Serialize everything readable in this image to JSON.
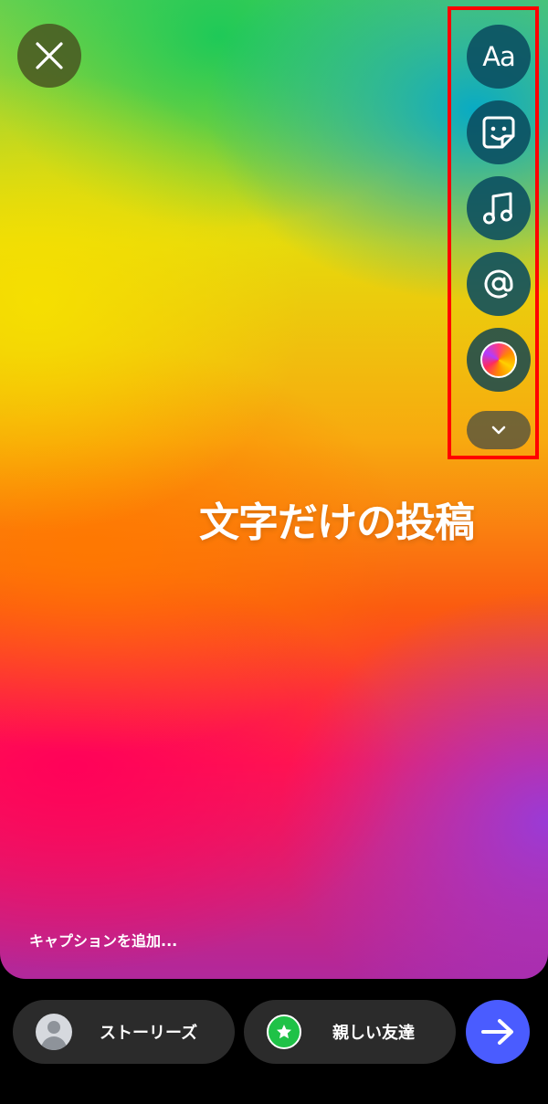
{
  "canvas": {
    "text": "文字だけの投稿",
    "caption_placeholder": "キャプションを追加..."
  },
  "toolbar": {
    "close_icon": "close-icon",
    "text_tool_label": "Aa",
    "tools": [
      "text-icon",
      "sticker-icon",
      "music-icon",
      "mention-icon",
      "color-gradient-icon",
      "chevron-down-icon"
    ]
  },
  "share": {
    "stories_label": "ストーリーズ",
    "close_friends_label": "親しい友達",
    "send_icon": "arrow-right-icon",
    "accent_color": "#4a5cff",
    "close_friends_color": "#1fc247"
  },
  "highlight": {
    "color": "#ff0000"
  }
}
